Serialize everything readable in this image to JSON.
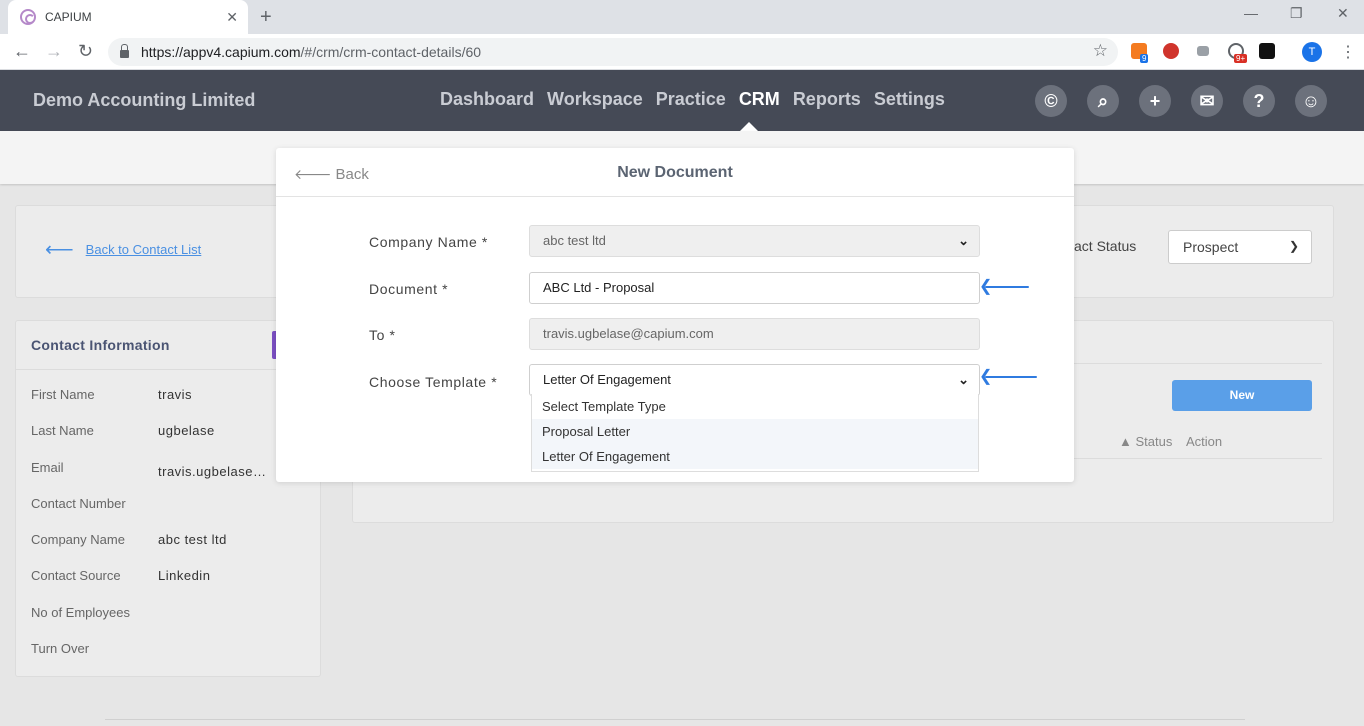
{
  "browser": {
    "tab_title": "CAPIUM",
    "url_host": "https://appv4.capium.com",
    "url_path": "/#/crm/crm-contact-details/60",
    "extension_badges": [
      "9",
      "9+"
    ],
    "profile_initial": "T"
  },
  "header": {
    "company": "Demo Accounting Limited",
    "nav": [
      "Dashboard",
      "Workspace",
      "Practice",
      "CRM",
      "Reports",
      "Settings"
    ],
    "active_nav": "CRM"
  },
  "page": {
    "back_link": "Back to Contact List",
    "contact_status_label": "act Status",
    "contact_status_value": "Prospect",
    "new_button": "New",
    "columns": {
      "status": "▲ Status",
      "action": "Action"
    }
  },
  "contact_info": {
    "title": "Contact Information",
    "rows": [
      {
        "label": "First Name",
        "value": "travis"
      },
      {
        "label": "Last Name",
        "value": "ugbelase"
      },
      {
        "label": "Email",
        "value": "travis.ugbelase@capium.com"
      },
      {
        "label": "Contact Number",
        "value": ""
      },
      {
        "label": "Company Name",
        "value": "abc test ltd"
      },
      {
        "label": "Contact Source",
        "value": "Linkedin"
      },
      {
        "label": "No of Employees",
        "value": ""
      },
      {
        "label": "Turn Over",
        "value": ""
      }
    ]
  },
  "modal": {
    "back": "Back",
    "title": "New Document",
    "fields": {
      "company_name": {
        "label": "Company Name *",
        "value": "abc test ltd"
      },
      "document": {
        "label": "Document *",
        "value": "ABC Ltd - Proposal"
      },
      "to": {
        "label": "To *",
        "value": "travis.ugbelase@capium.com"
      },
      "template": {
        "label": "Choose Template *",
        "value": "Letter Of Engagement"
      }
    },
    "template_options": [
      "Select Template Type",
      "Proposal Letter",
      "Letter Of Engagement"
    ],
    "highlighted_option": "Proposal Letter"
  },
  "colors": {
    "header_bg": "#454a56",
    "accent_blue": "#5a9fe8",
    "annotation_arrow": "#2f7be0"
  }
}
